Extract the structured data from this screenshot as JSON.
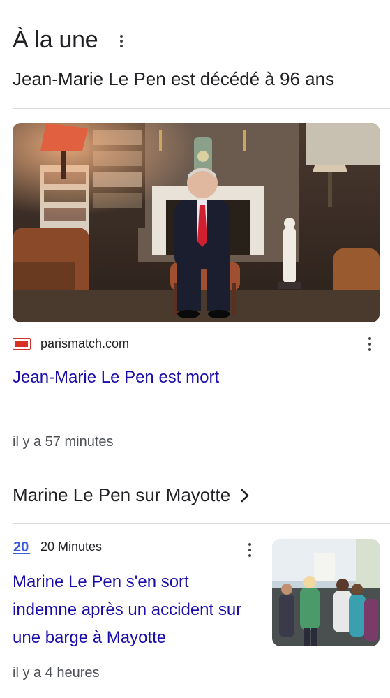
{
  "header": {
    "title": "À la une",
    "menu_icon": "more-vert-icon"
  },
  "top_story": {
    "headline": "Jean-Marie Le Pen est décédé à 96 ans",
    "source": "parismatch.com",
    "title": "Jean-Marie Le Pen est mort",
    "time": "il y a 57 minutes"
  },
  "topic": {
    "label": "Marine Le Pen sur Mayotte",
    "icon": "chevron-right-icon"
  },
  "second_story": {
    "source": "20 Minutes",
    "title": "Marine Le Pen s'en sort indemne après un accident sur une barge à Mayotte",
    "time": "il y a 4 heures"
  },
  "colors": {
    "link": "#1a0dab",
    "text": "#202124",
    "secondary": "#4d5156",
    "divider": "#dadce0",
    "parismatch_red": "#d93025",
    "twenty_minutes_blue": "#3b5bdb"
  }
}
